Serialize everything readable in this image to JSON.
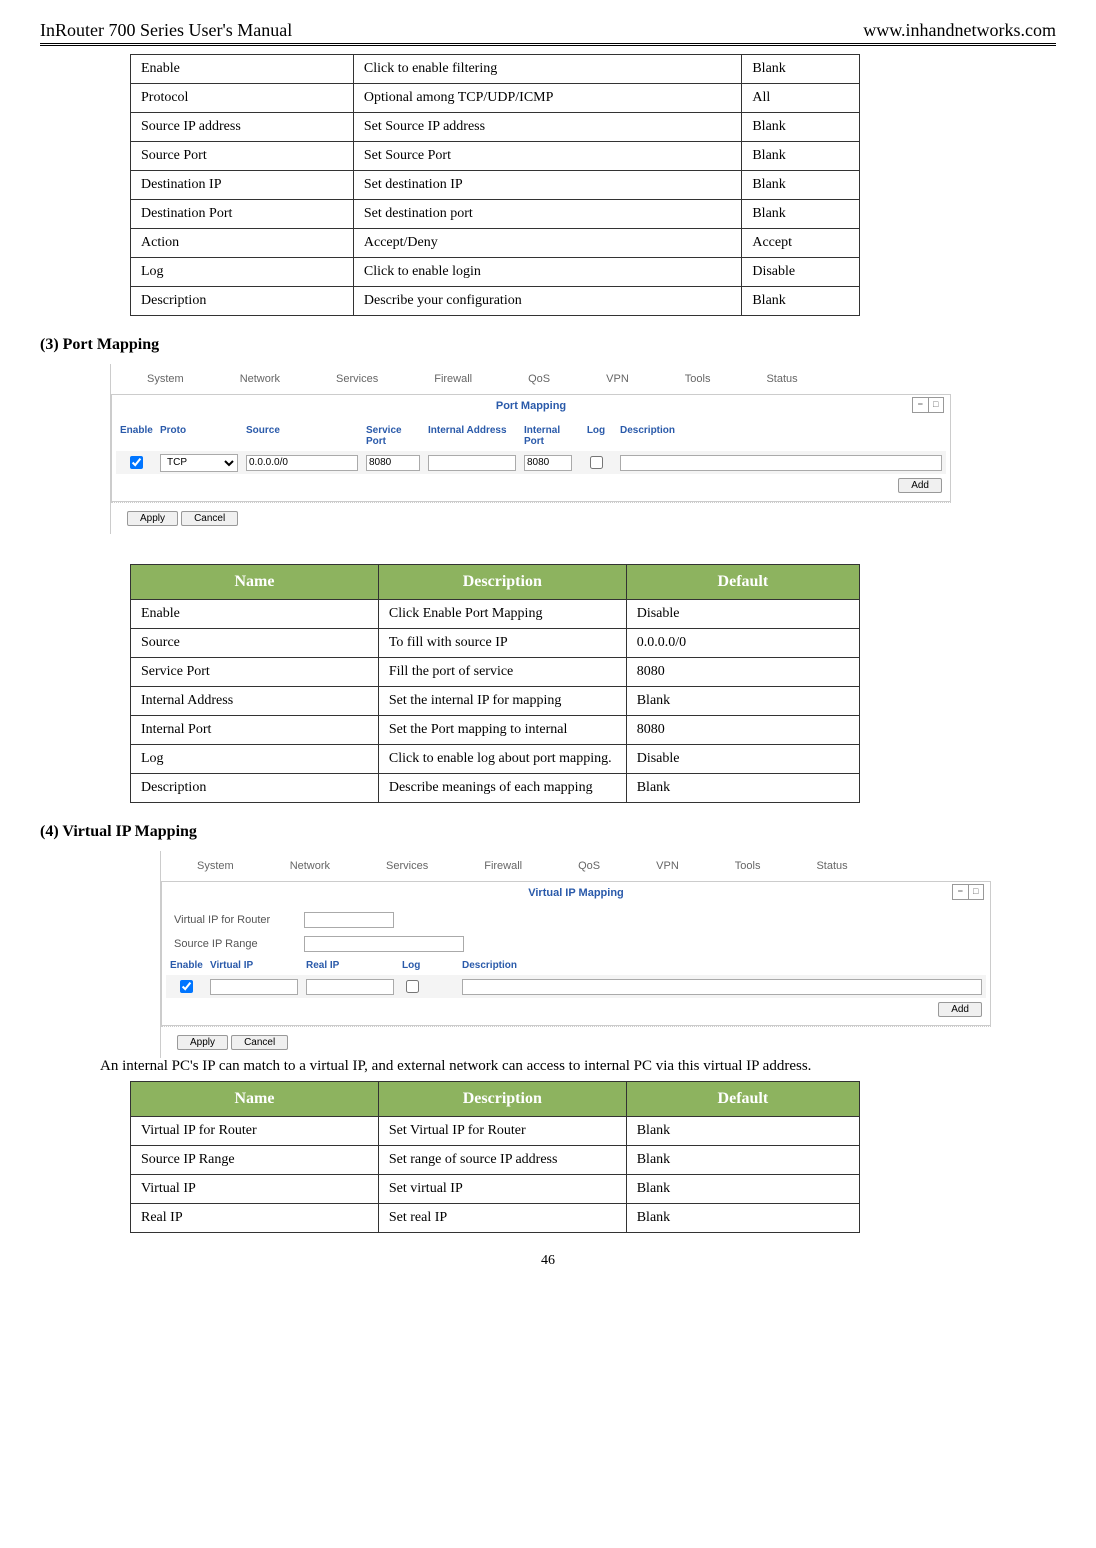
{
  "header": {
    "left": "InRouter 700 Series User's Manual",
    "right": "www.inhandnetworks.com"
  },
  "table1": {
    "rows": [
      {
        "name": "Enable",
        "desc": "Click to enable filtering",
        "def": "Blank"
      },
      {
        "name": "Protocol",
        "desc": "Optional among TCP/UDP/ICMP",
        "def": "All"
      },
      {
        "name": "Source IP address",
        "desc": "Set Source IP address",
        "def": "Blank"
      },
      {
        "name": "Source Port",
        "desc": "Set Source Port",
        "def": "Blank"
      },
      {
        "name": "Destination IP",
        "desc": "Set destination IP",
        "def": "Blank"
      },
      {
        "name": "Destination Port",
        "desc": "Set destination port",
        "def": "Blank"
      },
      {
        "name": "Action",
        "desc": "Accept/Deny",
        "def": "Accept"
      },
      {
        "name": "Log",
        "desc": "Click to enable login",
        "def": "Disable"
      },
      {
        "name": "Description",
        "desc": "Describe your configuration",
        "def": "Blank"
      }
    ]
  },
  "section3": {
    "heading": "(3)  Port Mapping"
  },
  "ui_tabs": [
    "System",
    "Network",
    "Services",
    "Firewall",
    "QoS",
    "VPN",
    "Tools",
    "Status"
  ],
  "ui_pm": {
    "title": "Port Mapping",
    "cols": {
      "enable": "Enable",
      "proto": "Proto",
      "source": "Source",
      "sport": "Service Port",
      "iaddr": "Internal Address",
      "iport": "Internal Port",
      "log": "Log",
      "desc": "Description"
    },
    "row": {
      "proto": "TCP",
      "source": "0.0.0.0/0",
      "sport": "8080",
      "iaddr": "",
      "iport": "8080",
      "desc": ""
    },
    "add": "Add",
    "apply": "Apply",
    "cancel": "Cancel"
  },
  "table2": {
    "headers": {
      "name": "Name",
      "desc": "Description",
      "def": "Default"
    },
    "rows": [
      {
        "name": "Enable",
        "desc": "Click Enable Port Mapping",
        "def": "Disable"
      },
      {
        "name": "Source",
        "desc": "To fill with source IP",
        "def": "0.0.0.0/0"
      },
      {
        "name": "Service Port",
        "desc": "Fill the port of service",
        "def": "8080"
      },
      {
        "name": "Internal Address",
        "desc": "Set the internal IP for mapping",
        "def": "Blank"
      },
      {
        "name": "Internal Port",
        "desc": "Set the Port mapping to internal",
        "def": "8080"
      },
      {
        "name": "Log",
        "desc": "Click to enable log about port mapping.",
        "def": "Disable"
      },
      {
        "name": "Description",
        "desc": "Describe meanings of each mapping",
        "def": "Blank"
      }
    ]
  },
  "section4": {
    "heading": "(4)  Virtual IP Mapping"
  },
  "ui_vip": {
    "title": "Virtual IP Mapping",
    "form": {
      "vip_router": "Virtual IP for Router",
      "src_range": "Source IP Range"
    },
    "cols": {
      "enable": "Enable",
      "vip": "Virtual IP",
      "rip": "Real IP",
      "log": "Log",
      "desc": "Description"
    },
    "add": "Add",
    "apply": "Apply",
    "cancel": "Cancel"
  },
  "body_text": "An internal PC's IP can match to a virtual IP, and external network can access to internal PC via this virtual IP address.",
  "table3": {
    "headers": {
      "name": "Name",
      "desc": "Description",
      "def": "Default"
    },
    "rows": [
      {
        "name": "Virtual IP for Router",
        "desc": "Set Virtual IP for Router",
        "def": "Blank"
      },
      {
        "name": "Source IP Range",
        "desc": "Set range of source IP address",
        "def": "Blank"
      },
      {
        "name": "Virtual IP",
        "desc": "Set virtual IP",
        "def": "Blank"
      },
      {
        "name": "Real IP",
        "desc": "Set real IP",
        "def": "Blank"
      }
    ]
  },
  "page_number": "46"
}
